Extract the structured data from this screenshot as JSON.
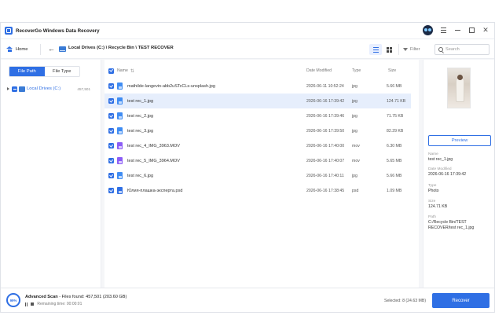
{
  "app": {
    "title": "RecoverGo Windows Data Recovery"
  },
  "toolbar": {
    "home_label": "Home",
    "breadcrumb": "Local Drives (C:) \\ Recycle Bin \\ TEST RECOVER",
    "filter_label": "Filter",
    "search_placeholder": "Search"
  },
  "left_panel": {
    "tabs": [
      {
        "label": "File Path",
        "active": true
      },
      {
        "label": "File Type",
        "active": false
      }
    ],
    "tree": [
      {
        "label": "Local Drives (C:)",
        "count": "457,501"
      }
    ]
  },
  "file_list": {
    "columns": {
      "name": "Name",
      "date": "Date Modified",
      "type": "Type",
      "size": "Size"
    },
    "rows": [
      {
        "name": "mathilde-langevin-abb2uSTcCLs-unsplash.jpg",
        "date": "2026-06-11 10:52:24",
        "type": "jpg",
        "size": "5.66 MB",
        "icon": "jpg",
        "selected": false
      },
      {
        "name": "test rec_1.jpg",
        "date": "2026-06-16 17:39:42",
        "type": "jpg",
        "size": "124.71 KB",
        "icon": "jpg",
        "selected": true
      },
      {
        "name": "test rec_2.jpg",
        "date": "2026-06-16 17:39:46",
        "type": "jpg",
        "size": "71.75 KB",
        "icon": "jpg",
        "selected": false
      },
      {
        "name": "test rec_3.jpg",
        "date": "2026-06-16 17:39:50",
        "type": "jpg",
        "size": "82.29 KB",
        "icon": "jpg",
        "selected": false
      },
      {
        "name": "test rec_4_IMG_3963.MOV",
        "date": "2026-06-16 17:40:00",
        "type": "mov",
        "size": "6.30 MB",
        "icon": "mov",
        "selected": false
      },
      {
        "name": "test rec_5_IMG_3964.MOV",
        "date": "2026-06-16 17:40:07",
        "type": "mov",
        "size": "5.65 MB",
        "icon": "mov",
        "selected": false
      },
      {
        "name": "test rec_6.jpg",
        "date": "2026-06-16 17:40:11",
        "type": "jpg",
        "size": "5.66 MB",
        "icon": "jpg",
        "selected": false
      },
      {
        "name": "Юлия-плашка-эксперта.psd",
        "date": "2026-06-16 17:38:45",
        "type": "psd",
        "size": "1.09 MB",
        "icon": "psd",
        "selected": false
      }
    ]
  },
  "preview": {
    "button_label": "Preview",
    "fields": [
      {
        "label": "Name",
        "value": "test rec_1.jpg"
      },
      {
        "label": "Date Modified",
        "value": "2026-06-16 17:39:42"
      },
      {
        "label": "Type",
        "value": "Photo"
      },
      {
        "label": "Size",
        "value": "124.71 KB"
      },
      {
        "label": "Path",
        "value": "C:/Recycle Bin/TEST RECOVER/test rec_1.jpg"
      }
    ]
  },
  "footer": {
    "progress": "99%",
    "scan_label": "Advanced Scan",
    "files_found": " - Files found: 457,501 (203.60 GB)",
    "remaining": "Remaining time: 00:00:01",
    "selected": "Selected: 8 (24.63 MB)",
    "recover_label": "Recover"
  },
  "colors": {
    "accent": "#2f6fe4",
    "selected_row": "#e6eefc",
    "mov_icon": "#8b5cf6"
  }
}
